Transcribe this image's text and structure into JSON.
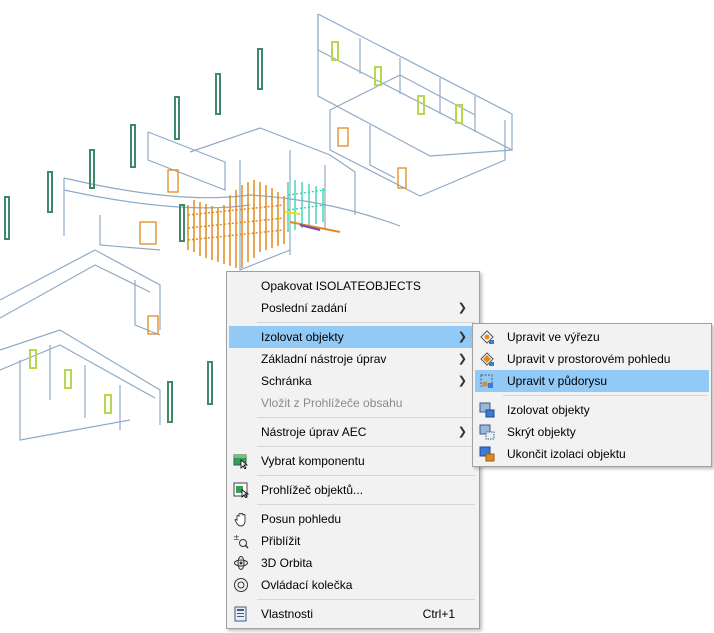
{
  "main_menu": {
    "repeat_isolate": "Opakovat ISOLATEOBJECTS",
    "recent_input": "Poslední zadání",
    "isolate_objects": "Izolovat objekty",
    "basic_modify_tools": "Základní nástroje úprav",
    "clipboard": "Schránka",
    "paste_from_content_browser": "Vložit z Prohlížeče obsahu",
    "aec_modify_tools": "Nástroje úprav AEC",
    "select_component": "Vybrat komponentu",
    "object_viewer": "Prohlížeč objektů...",
    "pan": "Posun pohledu",
    "zoom": "Přiblížit",
    "orbit_3d": "3D Orbita",
    "steering_wheels": "Ovládací kolečka",
    "properties": "Vlastnosti",
    "properties_shortcut": "Ctrl+1"
  },
  "sub_menu": {
    "edit_in_section": "Upravit ve výřezu",
    "edit_in_elevation": "Upravit v prostorovém pohledu",
    "edit_in_plan": "Upravit v půdorysu",
    "isolate_objects": "Izolovat objekty",
    "hide_objects": "Skrýt objekty",
    "end_object_isolation": "Ukončit izolaci objektu"
  },
  "colors": {
    "highlight": "#91c9f7",
    "menu_background": "#f2f2f2",
    "wall_outline": "#8faac8",
    "door_orange": "#e08a1e",
    "window_green": "#3d8a6a",
    "window_lime": "#b7d84a",
    "cyan_accent": "#2ed0a8"
  },
  "icons": {
    "submenu_arrow": "chevron-right-icon"
  }
}
